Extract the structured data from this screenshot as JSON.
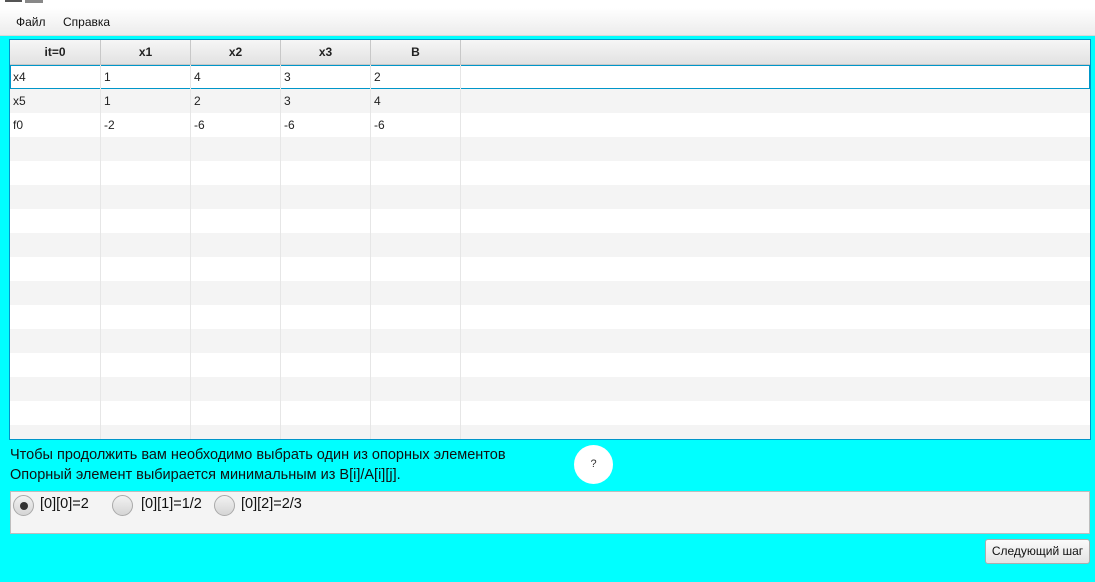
{
  "menu": {
    "file": "Файл",
    "help": "Справка"
  },
  "table": {
    "headers": [
      "it=0",
      "x1",
      "x2",
      "x3",
      "B"
    ],
    "rows": [
      [
        "x4",
        "1",
        "4",
        "3",
        "2"
      ],
      [
        "x5",
        "1",
        "2",
        "3",
        "4"
      ],
      [
        "f0",
        "-2",
        "-6",
        "-6",
        "-6"
      ]
    ],
    "selected_row": 0
  },
  "info": {
    "line1": "Чтобы продолжить вам необходимо выбрать один из опорных элементов",
    "line2": "Опорный элемент выбирается минимальным из B[i]/A[i][j].",
    "help_label": "?"
  },
  "options": [
    {
      "label": "[0][0]=2",
      "selected": true
    },
    {
      "label": "[0][1]=1/2",
      "selected": false
    },
    {
      "label": "[0][2]=2/3",
      "selected": false
    }
  ],
  "next_button": "Следующий шаг",
  "colors": {
    "background": "#00ffff",
    "selection": "#0096c9"
  }
}
